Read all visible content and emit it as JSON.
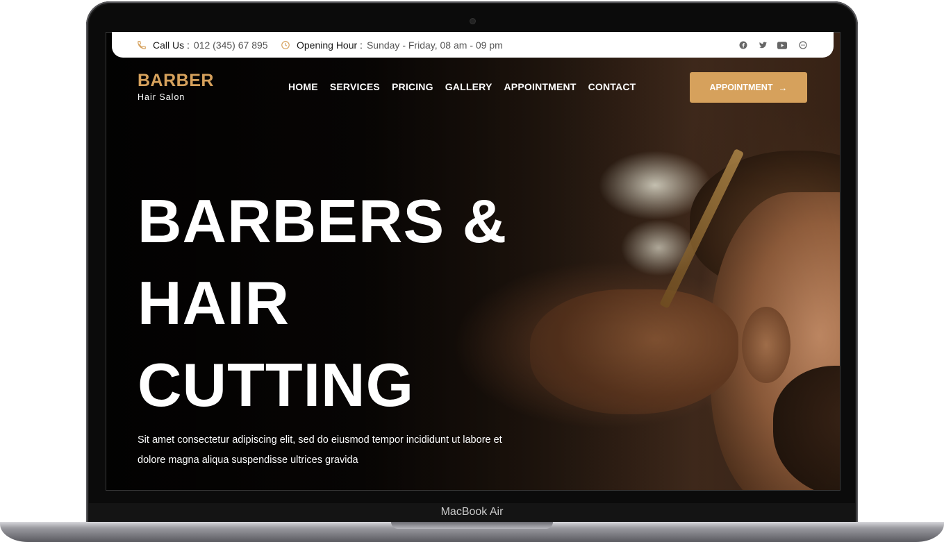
{
  "device": {
    "label": "MacBook Air"
  },
  "topbar": {
    "call_label": "Call Us :",
    "call_value": "012 (345) 67 895",
    "hours_label": "Opening Hour :",
    "hours_value": "Sunday - Friday, 08 am - 09 pm",
    "social_icons": [
      "facebook-icon",
      "twitter-icon",
      "youtube-icon",
      "chat-icon"
    ]
  },
  "brand": {
    "name": "BARBER",
    "tagline": "Hair Salon"
  },
  "nav": {
    "items": [
      "HOME",
      "SERVICES",
      "PRICING",
      "GALLERY",
      "APPOINTMENT",
      "CONTACT"
    ]
  },
  "cta": {
    "label": "APPOINTMENT",
    "icon": "arrow-right-icon"
  },
  "hero": {
    "headline_lines": [
      "BARBERS &",
      "HAIR",
      "CUTTING"
    ],
    "description_lines": [
      "Sit amet consectetur adipiscing elit, sed do eiusmod tempor incididunt ut labore et",
      "dolore magna aliqua suspendisse ultrices gravida"
    ]
  },
  "colors": {
    "accent": "#d6a15c",
    "text_light": "#ffffff"
  }
}
